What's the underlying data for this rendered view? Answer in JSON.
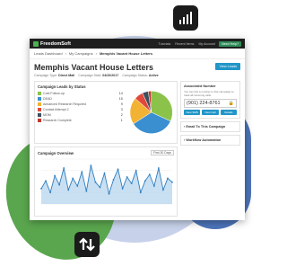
{
  "app": {
    "logo": "FreedomSoft",
    "nav": [
      "Tutorials",
      "Recent Items",
      "My Account"
    ],
    "help_label": "Need Help?"
  },
  "breadcrumb": [
    "Leads Dashboard",
    "My Campaigns",
    "Memphis Vacant House Letters"
  ],
  "page": {
    "title": "Memphis Vacant House Letters",
    "view_leads_label": "View Leads"
  },
  "meta": {
    "type_label": "Campaign Type:",
    "type_value": "Direct Mail",
    "start_label": "Campaign Start:",
    "start_value": "04/20/2017",
    "status_label": "Campaign Status:",
    "status_value": "Active"
  },
  "leads_by_status": {
    "title": "Campaign Leads by Status",
    "rows": [
      {
        "label": "Cold Follow-up",
        "value": "14",
        "color": "#8bc34a"
      },
      {
        "label": "DEAD",
        "value": "15",
        "color": "#3a8fd1"
      },
      {
        "label": "Advanced Research Required",
        "value": "9",
        "color": "#f2b233"
      },
      {
        "label": "Contact Attempt 2",
        "value": "3",
        "color": "#e0483b"
      },
      {
        "label": "MOM",
        "value": "2",
        "color": "#3e4f5e"
      },
      {
        "label": "Research Complete",
        "value": "1",
        "color": "#c0392b"
      }
    ]
  },
  "associated_number": {
    "title": "Associated Number",
    "hint": "You can link a number to this campaign to track all incoming calls.",
    "number": "(901) 224-8761",
    "buttons": [
      "New SMS",
      "New Call",
      "Details"
    ]
  },
  "collapsibles": [
    "Email To This Campaign",
    "Workflow Automation"
  ],
  "overview": {
    "title": "Campaign Overview",
    "range": "First 30 Days"
  },
  "chart_data": {
    "type": "area",
    "values": [
      12,
      18,
      9,
      22,
      15,
      28,
      11,
      20,
      14,
      25,
      10,
      30,
      17,
      13,
      24,
      8,
      19,
      27,
      12,
      21,
      16,
      26,
      9,
      18,
      23,
      14,
      28,
      11,
      20,
      17
    ],
    "ylim": [
      0,
      35
    ],
    "grid": true,
    "color": "#2d7fc1",
    "fill": "#bcd7ef"
  },
  "pie": {
    "values": [
      14,
      15,
      9,
      3,
      2,
      1
    ]
  }
}
